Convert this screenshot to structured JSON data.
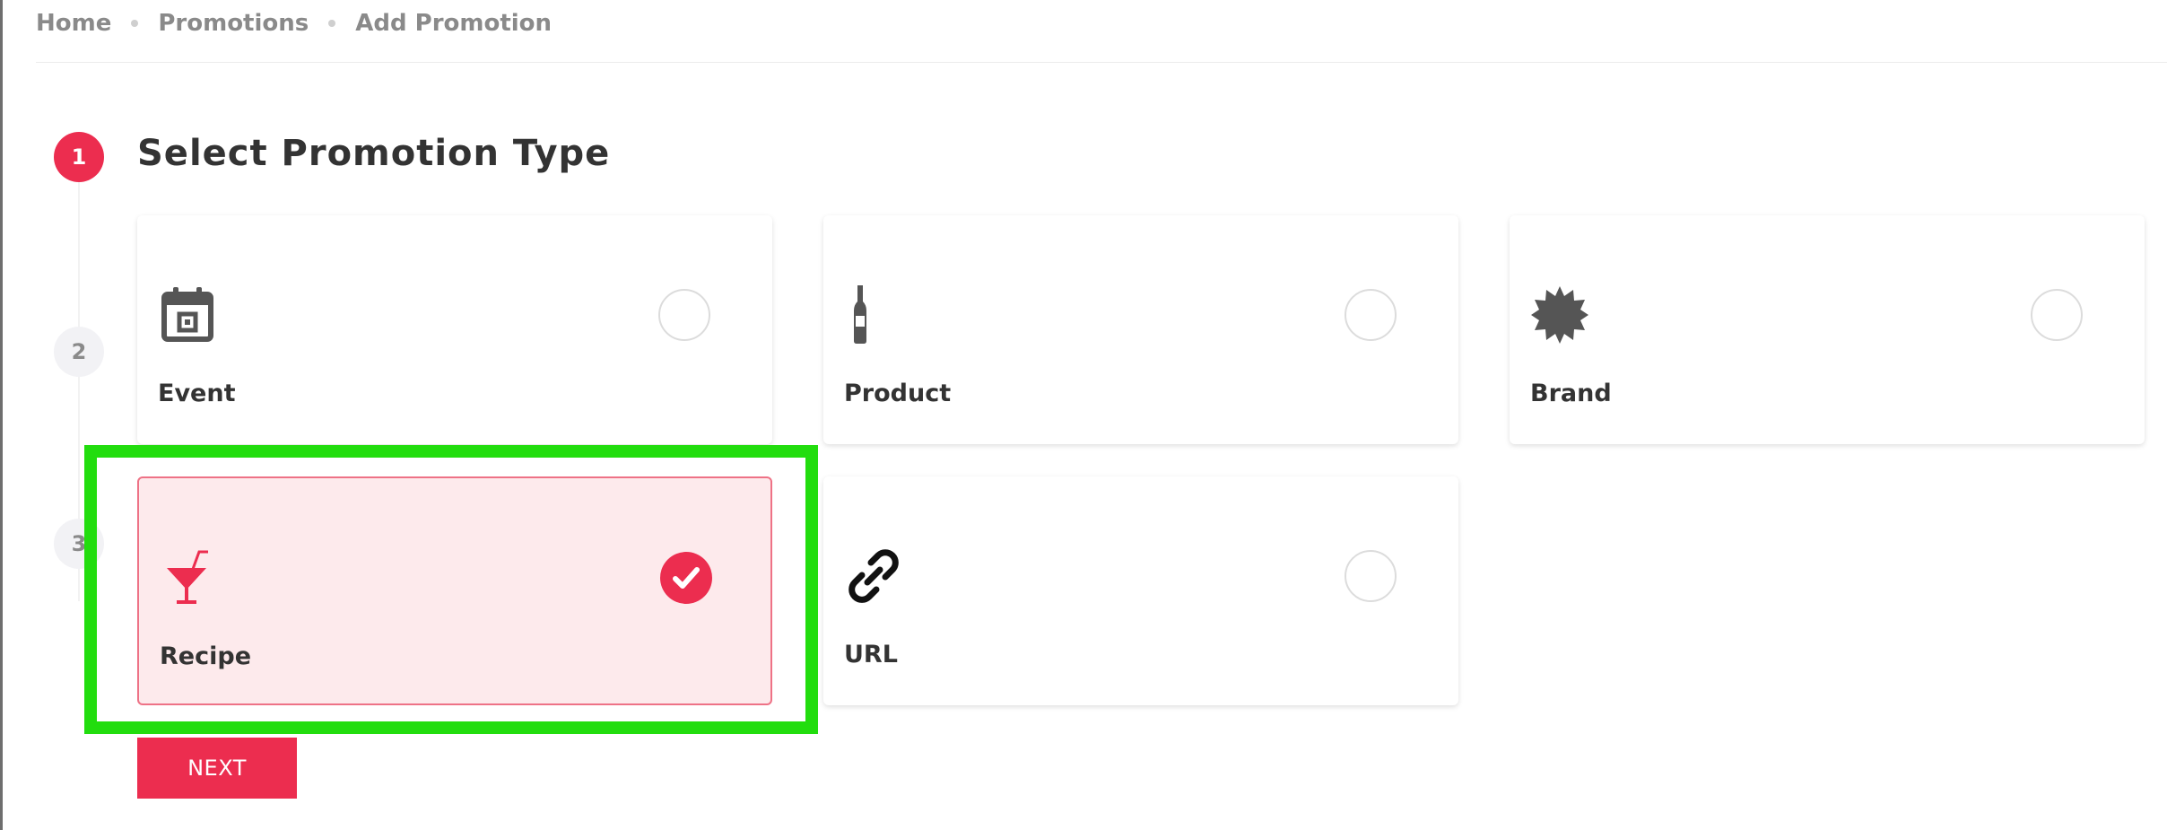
{
  "breadcrumb": {
    "items": [
      "Home",
      "Promotions",
      "Add Promotion"
    ]
  },
  "steps": [
    {
      "number": "1",
      "title": "Select Promotion Type",
      "active": true
    },
    {
      "number": "2",
      "active": false
    },
    {
      "number": "3",
      "active": false
    }
  ],
  "promotion_types": [
    {
      "label": "Event",
      "icon": "calendar-icon",
      "selected": false
    },
    {
      "label": "Product",
      "icon": "wine-bottle-icon",
      "selected": false
    },
    {
      "label": "Brand",
      "icon": "badge-icon",
      "selected": false
    },
    {
      "label": "Recipe",
      "icon": "cocktail-icon",
      "selected": true
    },
    {
      "label": "URL",
      "icon": "link-icon",
      "selected": false
    }
  ],
  "actions": {
    "next_label": "NEXT"
  },
  "colors": {
    "accent": "#ec2d4f",
    "selected_bg": "#fdeaec",
    "highlight": "#22dd0e",
    "icon_gray": "#555555"
  }
}
